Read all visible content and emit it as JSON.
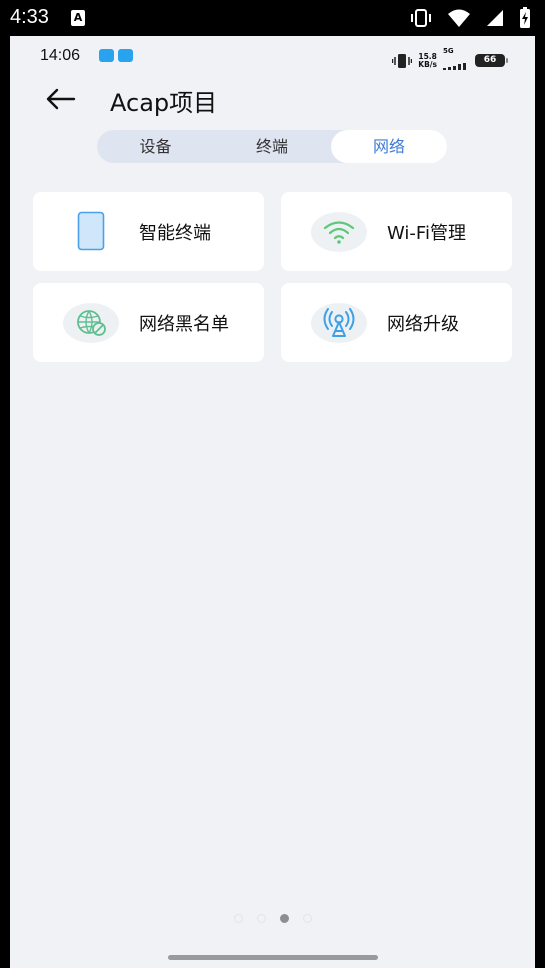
{
  "device_status": {
    "time": "4:33",
    "notification_icon": "A",
    "icons": [
      "vibrate-icon",
      "wifi-icon",
      "cellular-icon",
      "battery-charging-icon"
    ]
  },
  "app_status": {
    "time": "14:06",
    "app_icons": [
      "cloud-app-icon",
      "message-app-icon"
    ],
    "speed_value": "15.8",
    "speed_unit": "KB/s",
    "network": "5G",
    "battery": "66"
  },
  "header": {
    "back_icon": "arrow-left-icon",
    "title": "Acap项目"
  },
  "tabs": {
    "items": [
      {
        "label": "设备"
      },
      {
        "label": "终端"
      },
      {
        "label": "网络",
        "active": true
      }
    ],
    "accent": "#3e7bd6"
  },
  "cards": [
    {
      "label": "智能终端",
      "icon": "phone-icon"
    },
    {
      "label": "Wi-Fi管理",
      "icon": "wifi-icon"
    },
    {
      "label": "网络黑名单",
      "icon": "globe-blocked-icon"
    },
    {
      "label": "网络升级",
      "icon": "signal-tower-icon"
    }
  ],
  "pager": {
    "count": 4,
    "active_index": 2
  }
}
